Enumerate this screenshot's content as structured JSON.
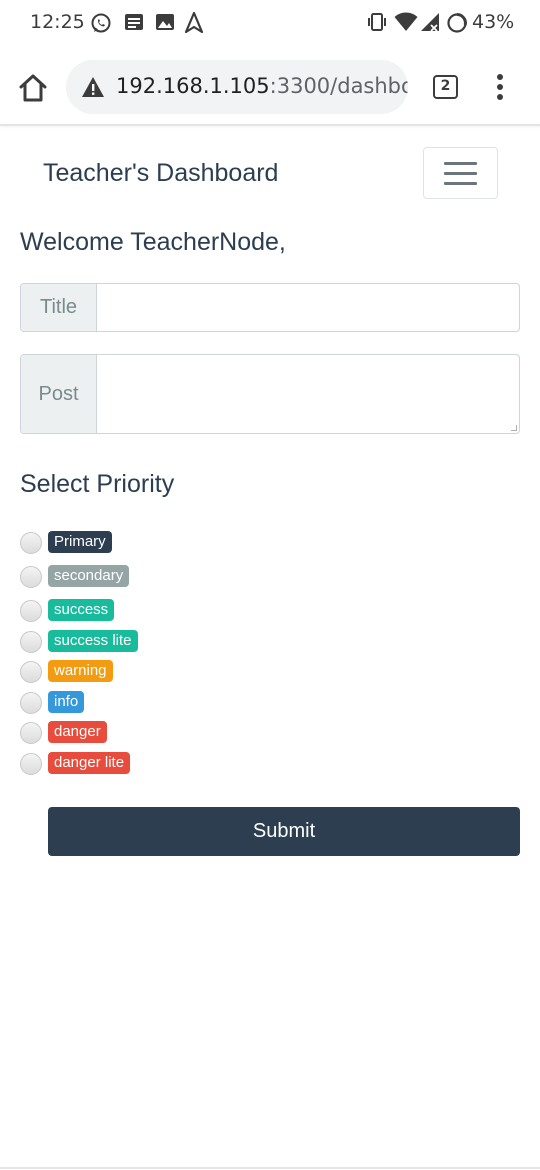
{
  "status_bar": {
    "time": "12:25",
    "battery": "43%",
    "icons": [
      "whatsapp-icon",
      "notes-icon",
      "image-icon",
      "navigation-icon",
      "vibrate-icon",
      "wifi-icon",
      "signal-icon",
      "battery-icon"
    ]
  },
  "browser": {
    "url_host": "192.168.1.105",
    "url_path": ":3300/dashbo",
    "tab_count": "2",
    "icons": [
      "home-icon",
      "warning-icon",
      "more-vert-icon"
    ]
  },
  "navbar": {
    "brand": "Teacher's Dashboard",
    "toggler_icon": "hamburger-icon"
  },
  "welcome": "Welcome TeacherNode,",
  "form": {
    "title_label": "Title",
    "title_value": "",
    "post_label": "Post",
    "post_value": "",
    "priority_heading": "Select Priority",
    "priorities": [
      {
        "label": "Primary",
        "color": "#2c3e50"
      },
      {
        "label": "secondary",
        "color": "#95a5a6"
      },
      {
        "label": "success",
        "color": "#18bc9c"
      },
      {
        "label": "success lite",
        "color": "#18bc9c"
      },
      {
        "label": "warning",
        "color": "#f39c12"
      },
      {
        "label": "info",
        "color": "#3498db"
      },
      {
        "label": "danger",
        "color": "#e74c3c"
      },
      {
        "label": "danger lite",
        "color": "#e74c3c"
      }
    ],
    "submit_label": "Submit"
  },
  "colors": {
    "primary": "#2c3e50",
    "addon_bg": "#ecf0f1",
    "border": "#ced4da"
  }
}
